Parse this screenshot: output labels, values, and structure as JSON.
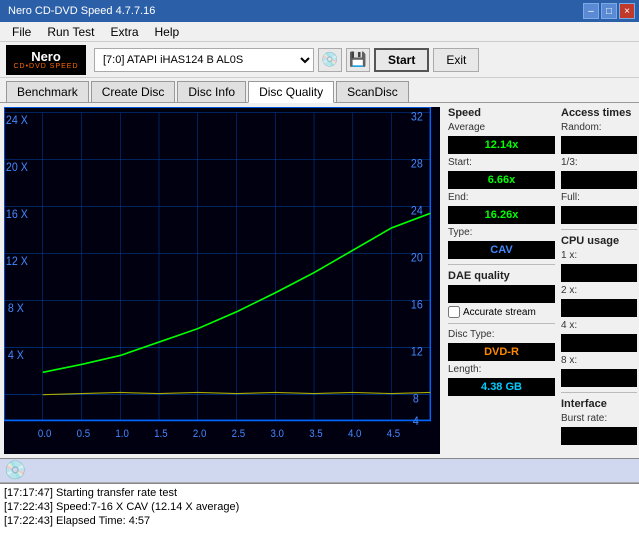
{
  "titleBar": {
    "title": "Nero CD-DVD Speed 4.7.7.16",
    "minimizeBtn": "–",
    "maximizeBtn": "□",
    "closeBtn": "×"
  },
  "menu": {
    "items": [
      "File",
      "Run Test",
      "Extra",
      "Help"
    ]
  },
  "toolbar": {
    "logoTop": "Nero",
    "logoBottom": "CD•DVD SPEED",
    "driveValue": "[7:0]  ATAPI iHAS124  B AL0S",
    "startLabel": "Start",
    "exitLabel": "Exit"
  },
  "tabs": {
    "items": [
      "Benchmark",
      "Create Disc",
      "Disc Info",
      "Disc Quality",
      "ScanDisc"
    ],
    "activeIndex": 3
  },
  "rightPanel": {
    "speedSection": {
      "title": "Speed",
      "averageLabel": "Average",
      "averageValue": "12.14x",
      "startLabel": "Start:",
      "startValue": "6.66x",
      "endLabel": "End:",
      "endValue": "16.26x",
      "typeLabel": "Type:",
      "typeValue": "CAV"
    },
    "accessSection": {
      "title": "Access times",
      "randomLabel": "Random:",
      "randomValue": "",
      "oneThirdLabel": "1/3:",
      "oneThirdValue": "",
      "fullLabel": "Full:",
      "fullValue": ""
    },
    "cpuSection": {
      "title": "CPU usage",
      "oneXLabel": "1 x:",
      "oneXValue": "",
      "twoXLabel": "2 x:",
      "twoXValue": "",
      "fourXLabel": "4 x:",
      "fourXValue": "",
      "eightXLabel": "8 x:",
      "eightXValue": ""
    },
    "daeSection": {
      "title": "DAE quality",
      "value": "",
      "accurateLabel": "Accurate stream"
    },
    "discSection": {
      "typeLabel": "Disc Type:",
      "typeValue": "DVD-R",
      "lengthLabel": "Length:",
      "lengthValue": "4.38 GB"
    },
    "interfaceSection": {
      "title": "Interface",
      "burstLabel": "Burst rate:"
    }
  },
  "log": {
    "entries": [
      "[17:17:47]  Starting transfer rate test",
      "[17:22:43]  Speed:7-16 X CAV (12.14 X average)",
      "[17:22:43]  Elapsed Time: 4:57"
    ]
  },
  "chart": {
    "yAxisLeft": [
      "24 X",
      "20 X",
      "16 X",
      "12 X",
      "8 X",
      "4 X"
    ],
    "yAxisRight": [
      "32",
      "28",
      "24",
      "20",
      "16",
      "12",
      "8",
      "4"
    ],
    "xAxis": [
      "0.0",
      "0.5",
      "1.0",
      "1.5",
      "2.0",
      "2.5",
      "3.0",
      "3.5",
      "4.0",
      "4.5"
    ]
  }
}
